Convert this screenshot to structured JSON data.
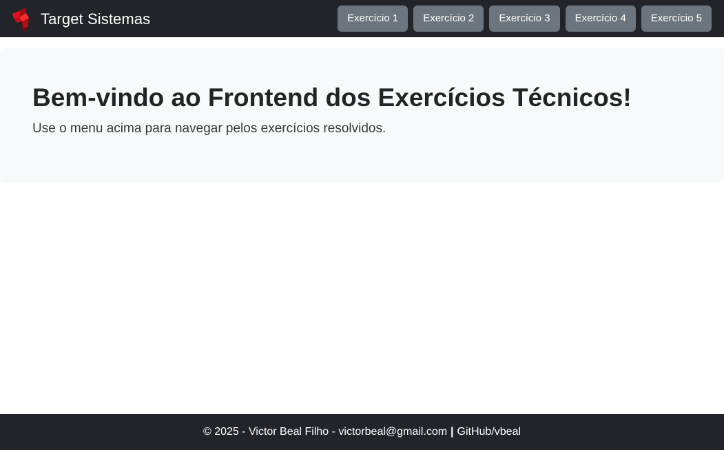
{
  "navbar": {
    "brand_text": "Target Sistemas",
    "brand_logo_icon": "target-sistemas-logo-icon",
    "buttons": [
      {
        "label": "Exercício 1"
      },
      {
        "label": "Exercício 2"
      },
      {
        "label": "Exercício 3"
      },
      {
        "label": "Exercício 4"
      },
      {
        "label": "Exercício 5"
      }
    ]
  },
  "hero": {
    "title": "Bem-vindo ao Frontend dos Exercícios Técnicos!",
    "lead": "Use o menu acima para navegar pelos exercícios resolvidos."
  },
  "footer": {
    "copyright": "© 2025 - Victor Beal Filho - victorbeal@gmail.com",
    "separator": "|",
    "github_link": "GitHub/vbeal"
  },
  "colors": {
    "navbar_bg": "#212529",
    "button_bg": "#6c757d",
    "hero_bg": "#f8f9fa",
    "logo_red": "#d0101a"
  }
}
